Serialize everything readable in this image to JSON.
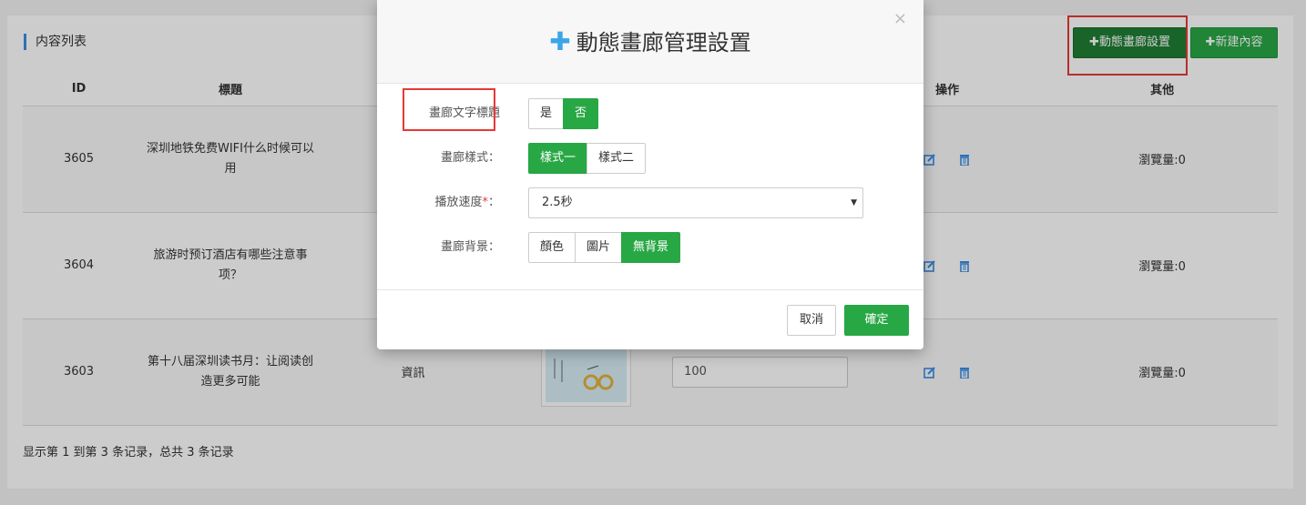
{
  "panel": {
    "title": "内容列表",
    "gallery_button": "✚動態畫廊設置",
    "new_button": "✚新建內容"
  },
  "table": {
    "headers": [
      "ID",
      "標題",
      "",
      "",
      "",
      "操作",
      "其他"
    ],
    "rows": [
      {
        "id": "3605",
        "title": "深圳地铁免费WIFI什么时候可以用",
        "category": "",
        "sort": "",
        "other": "瀏覽量:0"
      },
      {
        "id": "3604",
        "title": "旅游时预订酒店有哪些注意事项？",
        "category": "",
        "sort": "",
        "other": "瀏覽量:0"
      },
      {
        "id": "3603",
        "title": "第十八届深圳读书月：让阅读创造更多可能",
        "category": "資訊",
        "sort": "100",
        "other": "瀏覽量:0"
      }
    ]
  },
  "footer": {
    "summary": "显示第 1 到第 3 条记录，总共 3 条记录"
  },
  "modal": {
    "title_icon": "✚",
    "title": "動態畫廊管理設置",
    "close": "×",
    "fields": {
      "text_title": {
        "label": "畫廊文字標題",
        "options": [
          "是",
          "否"
        ],
        "selected": "否"
      },
      "style": {
        "label": "畫廊樣式：",
        "options": [
          "樣式一",
          "樣式二"
        ],
        "selected": "樣式一"
      },
      "speed": {
        "label": "播放速度",
        "required_mark": "*",
        "colon": "：",
        "value": "2.5秒"
      },
      "background": {
        "label": "畫廊背景：",
        "options": [
          "顏色",
          "圖片",
          "無背景"
        ],
        "selected": "無背景"
      }
    },
    "cancel": "取消",
    "ok": "確定"
  },
  "colors": {
    "accent_green": "#28a745",
    "dark_green": "#1e7e34",
    "highlight_red": "#e53935",
    "icon_blue": "#3a8ee6"
  }
}
